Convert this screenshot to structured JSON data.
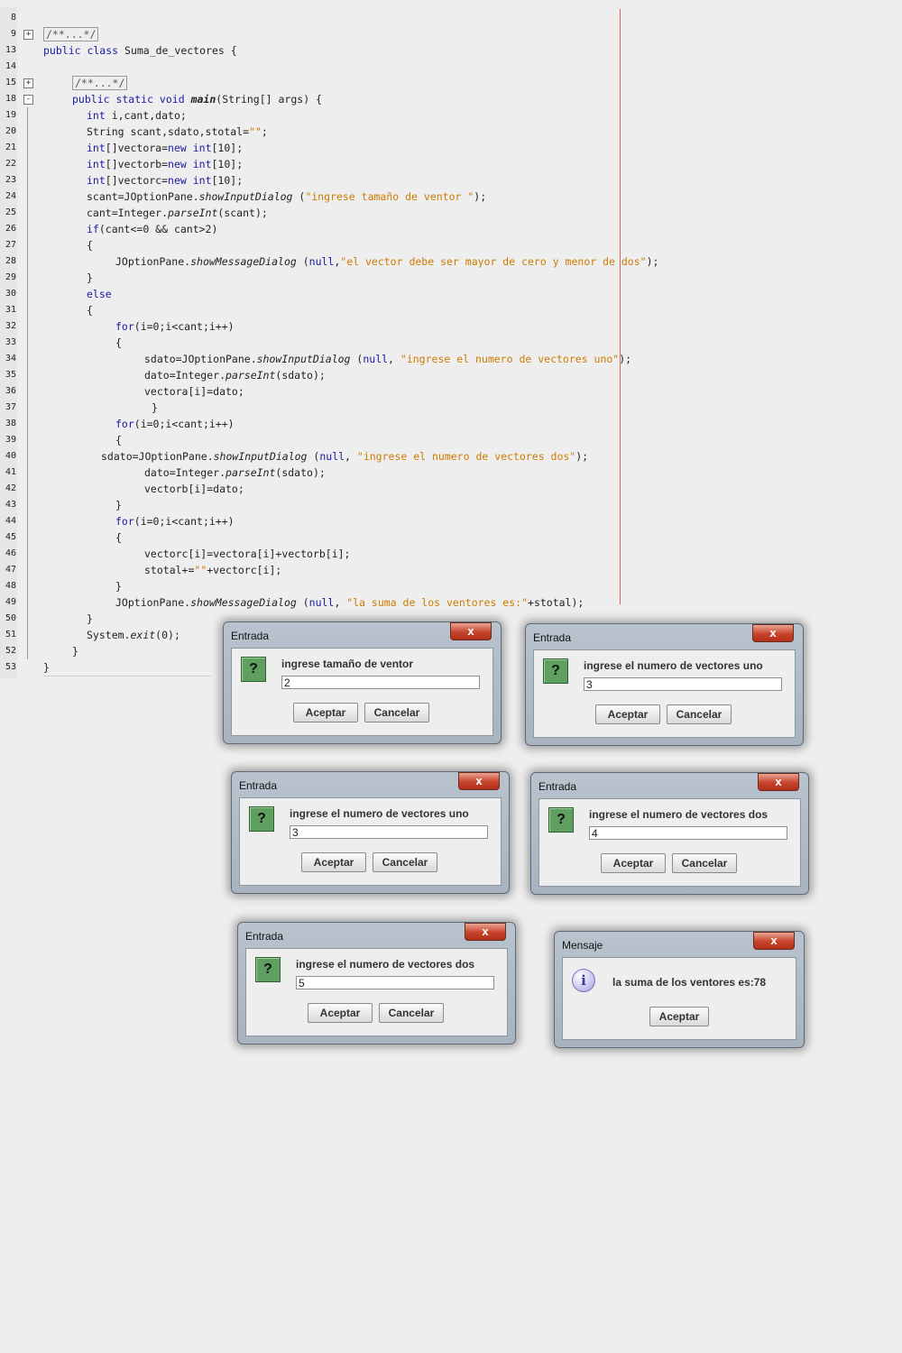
{
  "editor": {
    "lines": [
      {
        "n": "8",
        "fold": "",
        "tree": false,
        "indent": 0,
        "tokens": []
      },
      {
        "n": "9",
        "fold": "+",
        "tree": false,
        "indent": 48,
        "tokens": [
          {
            "t": "/**...*/",
            "c": "collapsed"
          }
        ]
      },
      {
        "n": "13",
        "fold": "",
        "tree": false,
        "indent": 48,
        "tokens": [
          {
            "t": "public class ",
            "c": "kw"
          },
          {
            "t": "Suma_de_vectores {",
            "c": ""
          }
        ]
      },
      {
        "n": "14",
        "fold": "",
        "tree": false,
        "indent": 48,
        "tokens": []
      },
      {
        "n": "15",
        "fold": "+",
        "tree": false,
        "indent": 80,
        "tokens": [
          {
            "t": "/**...*/",
            "c": "collapsed"
          }
        ]
      },
      {
        "n": "18",
        "fold": "-",
        "tree": false,
        "indent": 80,
        "tokens": [
          {
            "t": "public static void ",
            "c": "kw"
          },
          {
            "t": "main",
            "c": "bold"
          },
          {
            "t": "(String[] args) {",
            "c": ""
          }
        ]
      },
      {
        "n": "19",
        "fold": "",
        "tree": true,
        "indent": 96,
        "tokens": [
          {
            "t": "int ",
            "c": "kw"
          },
          {
            "t": "i,cant,dato;",
            "c": ""
          }
        ]
      },
      {
        "n": "20",
        "fold": "",
        "tree": true,
        "indent": 96,
        "tokens": [
          {
            "t": "String scant,sdato,stotal=",
            "c": ""
          },
          {
            "t": "\"\"",
            "c": "str"
          },
          {
            "t": ";",
            "c": ""
          }
        ]
      },
      {
        "n": "21",
        "fold": "",
        "tree": true,
        "indent": 96,
        "tokens": [
          {
            "t": "int",
            "c": "kw"
          },
          {
            "t": "[]vectora=",
            "c": ""
          },
          {
            "t": "new int",
            "c": "kw"
          },
          {
            "t": "[10];",
            "c": ""
          }
        ]
      },
      {
        "n": "22",
        "fold": "",
        "tree": true,
        "indent": 96,
        "tokens": [
          {
            "t": "int",
            "c": "kw"
          },
          {
            "t": "[]vectorb=",
            "c": ""
          },
          {
            "t": "new int",
            "c": "kw"
          },
          {
            "t": "[10];",
            "c": ""
          }
        ]
      },
      {
        "n": "23",
        "fold": "",
        "tree": true,
        "indent": 96,
        "tokens": [
          {
            "t": "int",
            "c": "kw"
          },
          {
            "t": "[]vectorc=",
            "c": ""
          },
          {
            "t": "new int",
            "c": "kw"
          },
          {
            "t": "[10];",
            "c": ""
          }
        ]
      },
      {
        "n": "24",
        "fold": "",
        "tree": true,
        "indent": 96,
        "tokens": [
          {
            "t": "scant=JOptionPane.",
            "c": ""
          },
          {
            "t": "showInputDialog",
            "c": "it"
          },
          {
            "t": " (",
            "c": ""
          },
          {
            "t": "\"ingrese tamaño de ventor \"",
            "c": "str"
          },
          {
            "t": ");",
            "c": ""
          }
        ]
      },
      {
        "n": "25",
        "fold": "",
        "tree": true,
        "indent": 96,
        "tokens": [
          {
            "t": "cant=Integer.",
            "c": ""
          },
          {
            "t": "parseInt",
            "c": "it"
          },
          {
            "t": "(scant);",
            "c": ""
          }
        ]
      },
      {
        "n": "26",
        "fold": "",
        "tree": true,
        "indent": 96,
        "tokens": [
          {
            "t": "if",
            "c": "kw"
          },
          {
            "t": "(cant<=0 && cant>2)",
            "c": ""
          }
        ]
      },
      {
        "n": "27",
        "fold": "",
        "tree": true,
        "indent": 96,
        "tokens": [
          {
            "t": "{",
            "c": ""
          }
        ]
      },
      {
        "n": "28",
        "fold": "",
        "tree": true,
        "indent": 128,
        "tokens": [
          {
            "t": "JOptionPane.",
            "c": ""
          },
          {
            "t": "showMessageDialog",
            "c": "it"
          },
          {
            "t": " (",
            "c": ""
          },
          {
            "t": "null",
            "c": "kw"
          },
          {
            "t": ",",
            "c": ""
          },
          {
            "t": "\"el vector debe ser mayor de cero y menor de dos\"",
            "c": "str"
          },
          {
            "t": ");",
            "c": ""
          }
        ]
      },
      {
        "n": "29",
        "fold": "",
        "tree": true,
        "indent": 96,
        "tokens": [
          {
            "t": "}",
            "c": ""
          }
        ]
      },
      {
        "n": "30",
        "fold": "",
        "tree": true,
        "indent": 96,
        "tokens": [
          {
            "t": "else",
            "c": "kw"
          }
        ]
      },
      {
        "n": "31",
        "fold": "",
        "tree": true,
        "indent": 96,
        "tokens": [
          {
            "t": "{",
            "c": ""
          }
        ]
      },
      {
        "n": "32",
        "fold": "",
        "tree": true,
        "indent": 128,
        "tokens": [
          {
            "t": "for",
            "c": "kw"
          },
          {
            "t": "(i=0;i<cant;i++)",
            "c": ""
          }
        ]
      },
      {
        "n": "33",
        "fold": "",
        "tree": true,
        "indent": 128,
        "tokens": [
          {
            "t": "{",
            "c": ""
          }
        ]
      },
      {
        "n": "34",
        "fold": "",
        "tree": true,
        "indent": 160,
        "tokens": [
          {
            "t": "sdato=JOptionPane.",
            "c": ""
          },
          {
            "t": "showInputDialog",
            "c": "it"
          },
          {
            "t": " (",
            "c": ""
          },
          {
            "t": "null",
            "c": "kw"
          },
          {
            "t": ", ",
            "c": ""
          },
          {
            "t": "\"ingrese el numero de vectores uno\"",
            "c": "str"
          },
          {
            "t": ");",
            "c": ""
          }
        ]
      },
      {
        "n": "35",
        "fold": "",
        "tree": true,
        "indent": 160,
        "tokens": [
          {
            "t": "dato=Integer.",
            "c": ""
          },
          {
            "t": "parseInt",
            "c": "it"
          },
          {
            "t": "(sdato);",
            "c": ""
          }
        ]
      },
      {
        "n": "36",
        "fold": "",
        "tree": true,
        "indent": 160,
        "tokens": [
          {
            "t": "vectora[i]=dato;",
            "c": ""
          }
        ]
      },
      {
        "n": "37",
        "fold": "",
        "tree": true,
        "indent": 168,
        "tokens": [
          {
            "t": "}",
            "c": ""
          }
        ]
      },
      {
        "n": "38",
        "fold": "",
        "tree": true,
        "indent": 128,
        "tokens": [
          {
            "t": "for",
            "c": "kw"
          },
          {
            "t": "(i=0;i<cant;i++)",
            "c": ""
          }
        ]
      },
      {
        "n": "39",
        "fold": "",
        "tree": true,
        "indent": 128,
        "tokens": [
          {
            "t": "{",
            "c": ""
          }
        ]
      },
      {
        "n": "40",
        "fold": "",
        "tree": true,
        "indent": 112,
        "tokens": [
          {
            "t": "sdato=JOptionPane.",
            "c": ""
          },
          {
            "t": "showInputDialog",
            "c": "it"
          },
          {
            "t": " (",
            "c": ""
          },
          {
            "t": "null",
            "c": "kw"
          },
          {
            "t": ", ",
            "c": ""
          },
          {
            "t": "\"ingrese el numero de vectores dos\"",
            "c": "str"
          },
          {
            "t": ");",
            "c": ""
          }
        ]
      },
      {
        "n": "41",
        "fold": "",
        "tree": true,
        "indent": 160,
        "tokens": [
          {
            "t": "dato=Integer.",
            "c": ""
          },
          {
            "t": "parseInt",
            "c": "it"
          },
          {
            "t": "(sdato);",
            "c": ""
          }
        ]
      },
      {
        "n": "42",
        "fold": "",
        "tree": true,
        "indent": 160,
        "tokens": [
          {
            "t": "vectorb[i]=dato;",
            "c": ""
          }
        ]
      },
      {
        "n": "43",
        "fold": "",
        "tree": true,
        "indent": 128,
        "tokens": [
          {
            "t": "}",
            "c": ""
          }
        ]
      },
      {
        "n": "44",
        "fold": "",
        "tree": true,
        "indent": 128,
        "tokens": [
          {
            "t": "for",
            "c": "kw"
          },
          {
            "t": "(i=0;i<cant;i++)",
            "c": ""
          }
        ]
      },
      {
        "n": "45",
        "fold": "",
        "tree": true,
        "indent": 128,
        "tokens": [
          {
            "t": "{",
            "c": ""
          }
        ]
      },
      {
        "n": "46",
        "fold": "",
        "tree": true,
        "indent": 160,
        "tokens": [
          {
            "t": "vectorc[i]=vectora[i]+vectorb[i];",
            "c": ""
          }
        ]
      },
      {
        "n": "47",
        "fold": "",
        "tree": true,
        "indent": 160,
        "tokens": [
          {
            "t": "stotal+=",
            "c": ""
          },
          {
            "t": "\"\"",
            "c": "str"
          },
          {
            "t": "+vectorc[i];",
            "c": ""
          }
        ]
      },
      {
        "n": "48",
        "fold": "",
        "tree": true,
        "indent": 128,
        "tokens": [
          {
            "t": "}",
            "c": ""
          }
        ]
      },
      {
        "n": "49",
        "fold": "",
        "tree": true,
        "indent": 128,
        "tokens": [
          {
            "t": "JOptionPane.",
            "c": ""
          },
          {
            "t": "showMessageDialog",
            "c": "it"
          },
          {
            "t": " (",
            "c": ""
          },
          {
            "t": "null",
            "c": "kw"
          },
          {
            "t": ", ",
            "c": ""
          },
          {
            "t": "\"la suma de los ventores es:\"",
            "c": "str"
          },
          {
            "t": "+stotal);",
            "c": ""
          }
        ]
      },
      {
        "n": "50",
        "fold": "",
        "tree": true,
        "indent": 96,
        "tokens": [
          {
            "t": "}",
            "c": ""
          }
        ]
      },
      {
        "n": "51",
        "fold": "",
        "tree": true,
        "indent": 96,
        "tokens": [
          {
            "t": "System.",
            "c": ""
          },
          {
            "t": "exit",
            "c": "it"
          },
          {
            "t": "(0);",
            "c": ""
          }
        ]
      },
      {
        "n": "52",
        "fold": "",
        "tree": true,
        "indent": 80,
        "tokens": [
          {
            "t": "}",
            "c": ""
          }
        ]
      },
      {
        "n": "53",
        "fold": "",
        "tree": false,
        "indent": 48,
        "tokens": [
          {
            "t": "}",
            "c": ""
          }
        ]
      }
    ]
  },
  "dialogs": [
    {
      "kind": "input",
      "title": "Entrada",
      "close": "x",
      "prompt": "ingrese tamaño de ventor",
      "value": "2",
      "ok": "Aceptar",
      "cancel": "Cancelar"
    },
    {
      "kind": "input",
      "title": "Entrada",
      "close": "x",
      "prompt": "ingrese el numero de vectores uno",
      "value": "3",
      "ok": "Aceptar",
      "cancel": "Cancelar"
    },
    {
      "kind": "input",
      "title": "Entrada",
      "close": "x",
      "prompt": "ingrese el numero de vectores uno",
      "value": "3",
      "ok": "Aceptar",
      "cancel": "Cancelar"
    },
    {
      "kind": "input",
      "title": "Entrada",
      "close": "x",
      "prompt": "ingrese el numero de vectores dos",
      "value": "4",
      "ok": "Aceptar",
      "cancel": "Cancelar"
    },
    {
      "kind": "input",
      "title": "Entrada",
      "close": "x",
      "prompt": "ingrese el numero de vectores dos",
      "value": "5",
      "ok": "Aceptar",
      "cancel": "Cancelar"
    },
    {
      "kind": "message",
      "title": "Mensaje",
      "close": "x",
      "message": "la suma de los ventores es:78",
      "ok": "Aceptar"
    }
  ],
  "icons": {
    "question": "?",
    "info": "i"
  }
}
